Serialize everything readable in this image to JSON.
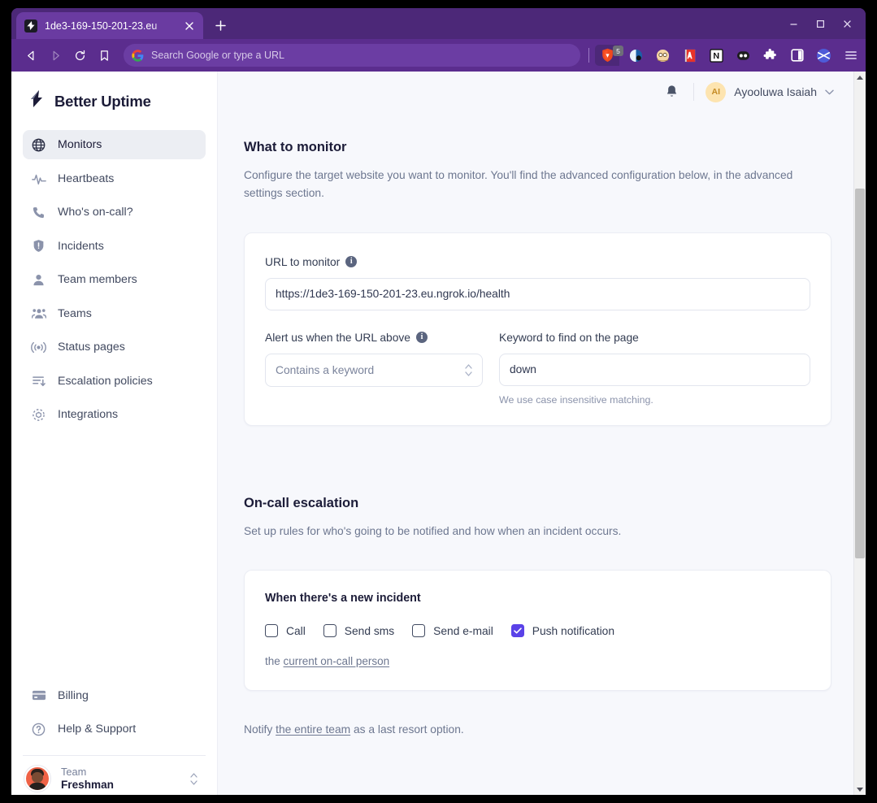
{
  "browser": {
    "tab": {
      "title": "1de3-169-150-201-23.eu",
      "favicon_icon": "bolt-icon",
      "close_icon": "close-icon"
    },
    "new_tab_label": "+",
    "window_controls": {
      "minimize": "–",
      "maximize": "☐",
      "close": "✕"
    },
    "nav": {
      "back_icon": "back-arrow-icon",
      "forward_icon": "forward-arrow-icon",
      "reload_icon": "reload-icon",
      "bookmark_icon": "bookmark-icon"
    },
    "omnibox": {
      "placeholder": "Search Google or type a URL",
      "search_engine_icon": "google-logo-icon"
    },
    "extensions": {
      "brave_shield_count": "5",
      "items": [
        "brave-shield-icon",
        "dark-reader-icon",
        "grammarly-icon",
        "dictionary-icon",
        "notion-icon",
        "loom-icon",
        "puzzle-extensions-icon",
        "sidebar-panel-icon",
        "brave-rewards-icon",
        "browser-menu-icon"
      ]
    },
    "colors": {
      "chrome_bg": "#5b2d8e",
      "tab_strip_bg": "#4c2878",
      "active_tab_bg": "#6a3ba1"
    }
  },
  "app": {
    "brand": {
      "name": "Better Uptime",
      "logo_icon": "bolt-logo-icon"
    },
    "sidebar": {
      "items": [
        {
          "label": "Monitors",
          "icon": "globe-icon",
          "active": true
        },
        {
          "label": "Heartbeats",
          "icon": "pulse-icon",
          "active": false
        },
        {
          "label": "Who's on-call?",
          "icon": "phone-icon",
          "active": false
        },
        {
          "label": "Incidents",
          "icon": "shield-alert-icon",
          "active": false
        },
        {
          "label": "Team members",
          "icon": "person-icon",
          "active": false
        },
        {
          "label": "Teams",
          "icon": "people-icon",
          "active": false
        },
        {
          "label": "Status pages",
          "icon": "broadcast-icon",
          "active": false
        },
        {
          "label": "Escalation policies",
          "icon": "list-arrow-down-icon",
          "active": false
        },
        {
          "label": "Integrations",
          "icon": "integrations-icon",
          "active": false
        }
      ],
      "bottom_items": [
        {
          "label": "Billing",
          "icon": "credit-card-icon"
        },
        {
          "label": "Help & Support",
          "icon": "question-circle-icon"
        }
      ],
      "team": {
        "label": "Team",
        "name": "Freshman",
        "switcher_icon": "up-down-chevron-icon",
        "avatar_icon": "user-avatar-photo"
      }
    },
    "topbar": {
      "notifications_icon": "bell-icon",
      "user": {
        "initials": "AI",
        "name": "Ayooluwa Isaiah",
        "dropdown_icon": "chevron-down-icon",
        "avatar_bg": "#fde4b0"
      }
    },
    "main": {
      "what_to_monitor": {
        "title": "What to monitor",
        "description": "Configure the target website you want to monitor. You'll find the advanced configuration below, in the advanced settings section.",
        "url_field": {
          "label": "URL to monitor",
          "info_icon": "info-icon",
          "value": "https://1de3-169-150-201-23.eu.ngrok.io/health"
        },
        "alert_field": {
          "label": "Alert us when the URL above",
          "info_icon": "info-icon",
          "selected": "Contains a keyword",
          "spinner_icon": "up-down-chevron-icon"
        },
        "keyword_field": {
          "label": "Keyword to find on the page",
          "value": "down",
          "help": "We use case insensitive matching."
        }
      },
      "on_call_escalation": {
        "title": "On-call escalation",
        "description": "Set up rules for who's going to be notified and how when an incident occurs.",
        "card": {
          "heading": "When there's a new incident",
          "checkboxes": [
            {
              "label": "Call",
              "checked": false
            },
            {
              "label": "Send sms",
              "checked": false
            },
            {
              "label": "Send e-mail",
              "checked": false
            },
            {
              "label": "Push notification",
              "checked": true
            }
          ],
          "assign_prefix": "the ",
          "assign_link": "current on-call person"
        },
        "notify": {
          "prefix": "Notify ",
          "link": "the entire team",
          "suffix": " as a last resort option."
        }
      }
    },
    "colors": {
      "accent": "#5a42e8",
      "page_bg": "#f7f8fc",
      "card_bg": "#ffffff",
      "text_primary": "#1c1c38",
      "text_muted": "#6d7790"
    }
  }
}
